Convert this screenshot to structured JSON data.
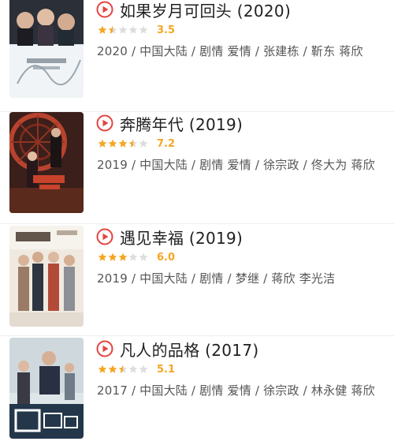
{
  "colors": {
    "accent": "#e5433f",
    "star_filled": "#f5a623",
    "star_empty": "#dddddd",
    "title": "#1f1f1f",
    "meta": "#555555"
  },
  "items": [
    {
      "title": "如果岁月可回头 (2020)",
      "rating": 3.5,
      "rating_text": "3.5",
      "stars_out_of_5": 1.75,
      "meta": "2020 / 中国大陆 / 剧情 爱情 / 张建栋 / 靳东 蒋欣",
      "icon": "play-circle-icon"
    },
    {
      "title": "奔腾年代 (2019)",
      "rating": 7.2,
      "rating_text": "7.2",
      "stars_out_of_5": 3.6,
      "meta": "2019 / 中国大陆 / 剧情 爱情 / 徐宗政 / 佟大为 蒋欣",
      "icon": "play-circle-icon"
    },
    {
      "title": "遇见幸福 (2019)",
      "rating": 6.0,
      "rating_text": "6.0",
      "stars_out_of_5": 3.0,
      "meta": "2019 / 中国大陆 / 剧情 / 梦继 / 蒋欣 李光洁",
      "icon": "play-circle-icon"
    },
    {
      "title": "凡人的品格 (2017)",
      "rating": 5.1,
      "rating_text": "5.1",
      "stars_out_of_5": 2.55,
      "meta": "2017 / 中国大陆 / 剧情 爱情 / 徐宗政 / 林永健 蒋欣",
      "icon": "play-circle-icon"
    }
  ]
}
